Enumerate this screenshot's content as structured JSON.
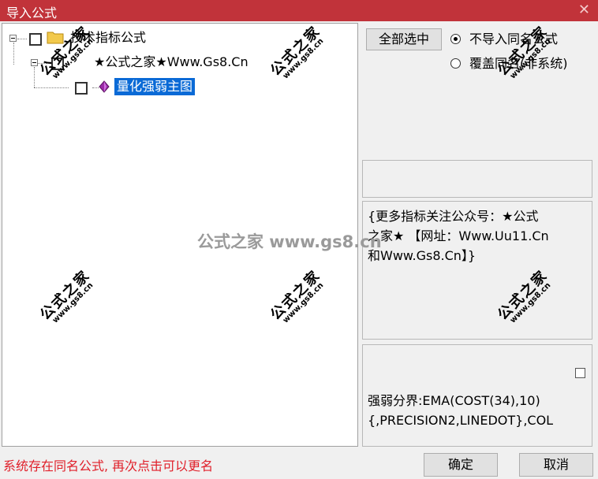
{
  "window": {
    "title": "导入公式",
    "close_glyph": "✕"
  },
  "tree": {
    "root": {
      "label": "技术指标公式",
      "checked": false
    },
    "child": {
      "label": "★公式之家★Www.Gs8.Cn",
      "checked": false
    },
    "leaf": {
      "label": "量化强弱主图",
      "checked": false,
      "selected": true
    }
  },
  "toolbar": {
    "select_all_label": "全部选中"
  },
  "import_mode": {
    "options": [
      {
        "label": "不导入同名公式",
        "selected": true
      },
      {
        "label": "覆盖同名(非系统)",
        "selected": false
      }
    ]
  },
  "description": {
    "line1": "{更多指标关注公众号：★公式",
    "line2": "之家★ 【网址：Www.Uu11.Cn",
    "line3": "和Www.Gs8.Cn】}"
  },
  "formula": {
    "line1": "强弱分界:EMA(COST(34),10)",
    "line2": "{,PRECISION2,LINEDOT},COL"
  },
  "status_text": "系统存在同名公式, 再次点击可以更名",
  "buttons": {
    "ok_label": "确定",
    "cancel_label": "取消"
  },
  "watermark": {
    "big": "公式之家",
    "small": "www.gs8.cn",
    "center": "公式之家 www.gs8.cn"
  },
  "colors": {
    "titlebar": "#c1333a",
    "selection": "#0a6ad6",
    "status": "#e0202a",
    "folder": "#f2c94c",
    "gem": "#9b2aa8"
  }
}
